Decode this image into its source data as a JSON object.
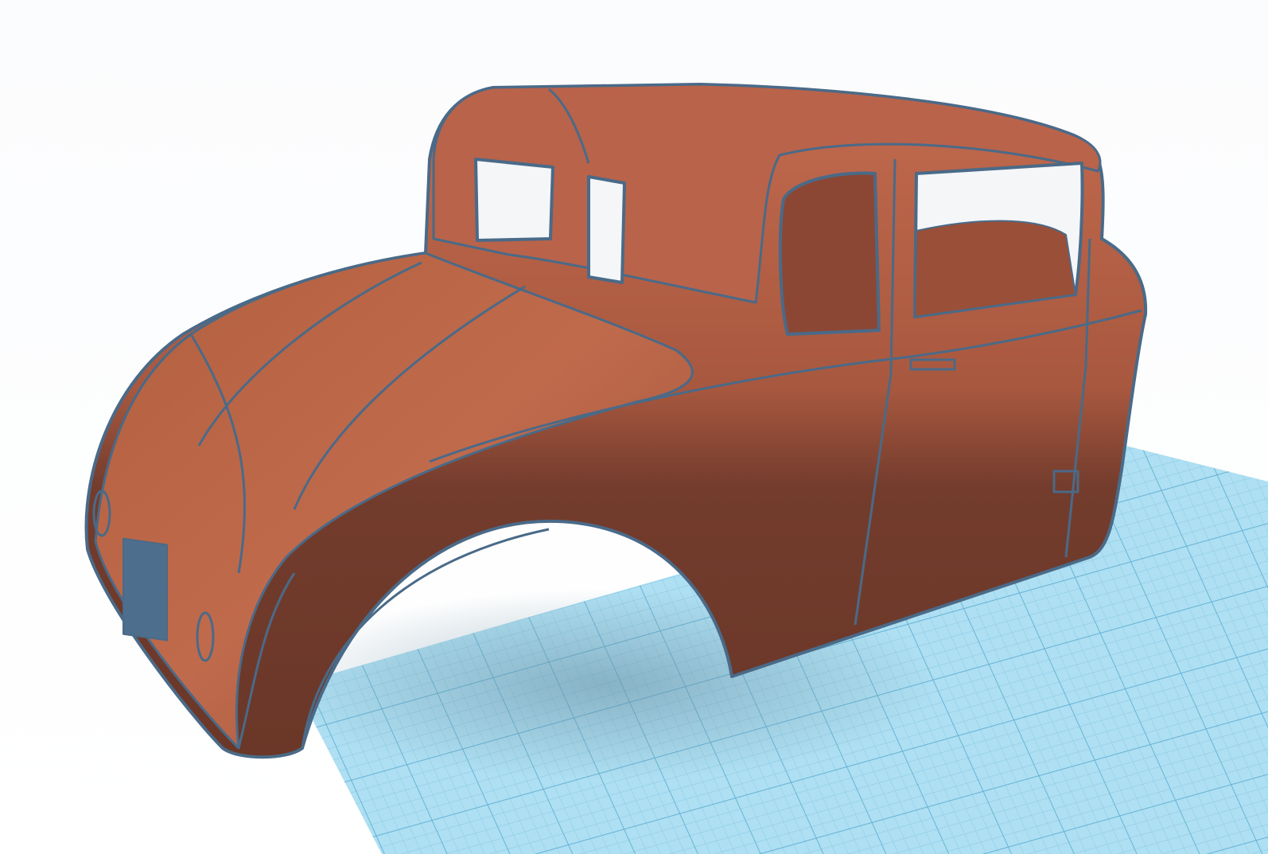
{
  "viewport": {
    "background_color": "#fcfdfe",
    "workplane_color": "#a9dcf0",
    "workplane_line_color": "#6fb8d8",
    "model_color": "#b9634a",
    "model_shadow_color": "#6e3a2c",
    "edge_color": "#4a6a88"
  }
}
